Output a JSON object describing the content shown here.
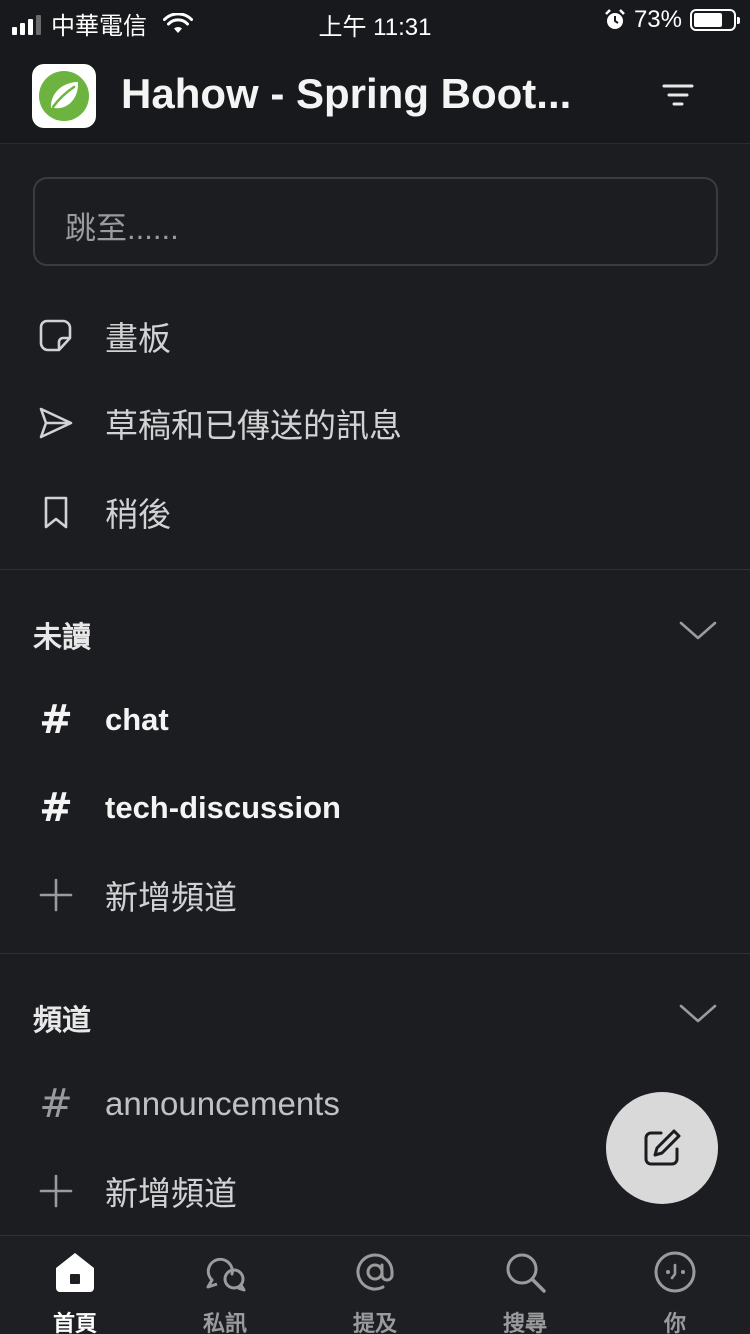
{
  "status_bar": {
    "carrier": "中華電信",
    "time": "上午 11:31",
    "battery": "73%",
    "battery_level": 0.73
  },
  "header": {
    "workspace_name": "Hahow - Spring Boot..."
  },
  "jump": {
    "placeholder": "跳至......"
  },
  "quick_nav": [
    {
      "label": "畫板",
      "icon": "canvas-icon"
    },
    {
      "label": "草稿和已傳送的訊息",
      "icon": "send-icon"
    },
    {
      "label": "稍後",
      "icon": "bookmark-icon"
    }
  ],
  "sections": {
    "unread": {
      "title": "未讀",
      "channels": [
        "chat",
        "tech-discussion"
      ],
      "add_label": "新增頻道"
    },
    "channels": {
      "title": "頻道",
      "channels": [
        "announcements"
      ],
      "add_label": "新增頻道"
    }
  },
  "tabs": [
    {
      "label": "首頁",
      "icon": "home-icon",
      "active": true
    },
    {
      "label": "私訊",
      "icon": "dm-icon",
      "active": false
    },
    {
      "label": "提及",
      "icon": "at-icon",
      "active": false
    },
    {
      "label": "搜尋",
      "icon": "search-icon",
      "active": false
    },
    {
      "label": "你",
      "icon": "you-icon",
      "active": false
    }
  ],
  "colors": {
    "background": "#1b1d21",
    "logo_green": "#6db33f",
    "fab": "#d9d9d9"
  }
}
